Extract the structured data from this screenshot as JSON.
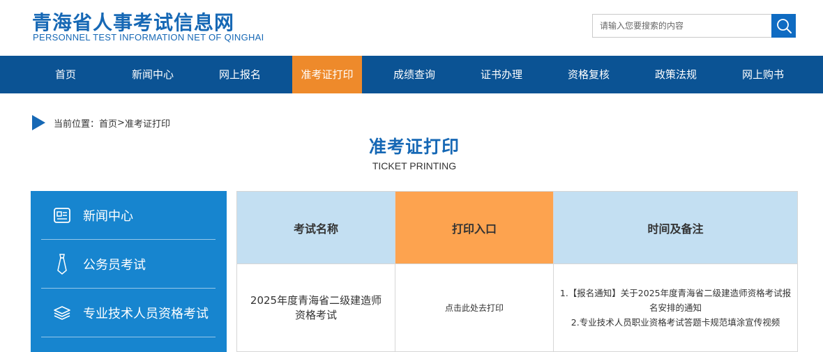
{
  "header": {
    "logo_cn": "青海省人事考试信息网",
    "logo_en": "PERSONNEL TEST INFORMATION NET OF QINGHAI",
    "search_placeholder": "请输入您要搜索的内容",
    "search_icon": "search-icon"
  },
  "nav": {
    "items": [
      {
        "label": "首页",
        "active": false
      },
      {
        "label": "新闻中心",
        "active": false
      },
      {
        "label": "网上报名",
        "active": false
      },
      {
        "label": "准考证打印",
        "active": true
      },
      {
        "label": "成绩查询",
        "active": false
      },
      {
        "label": "证书办理",
        "active": false
      },
      {
        "label": "资格复核",
        "active": false
      },
      {
        "label": "政策法规",
        "active": false
      },
      {
        "label": "网上购书",
        "active": false
      }
    ]
  },
  "breadcrumb": {
    "prefix": "当前位置：",
    "home": "首页",
    "separator": ">",
    "current": "准考证打印"
  },
  "page": {
    "title": "准考证打印",
    "subtitle": "TICKET PRINTING"
  },
  "sidebar": {
    "items": [
      {
        "label": "新闻中心",
        "icon": "news-icon"
      },
      {
        "label": "公务员考试",
        "icon": "tie-icon"
      },
      {
        "label": "专业技术人员资格考试",
        "icon": "layers-icon"
      }
    ]
  },
  "table": {
    "headers": [
      "考试名称",
      "打印入口",
      "时间及备注"
    ],
    "rows": [
      {
        "exam_name": "2025年度青海省二级建造师资格考试",
        "print_link": "点击此处去打印",
        "notes": [
          "1.【报名通知】关于2025年度青海省二级建造师资格考试报名安排的通知",
          "2.专业技术人员职业资格考试答题卡规范填涂宣传视频"
        ]
      }
    ]
  },
  "colors": {
    "brand_blue": "#1668b5",
    "nav_blue": "#0b5394",
    "active_orange": "#ee8a2b",
    "sidebar_blue": "#1785cf",
    "header_light_blue": "#c3dff2",
    "header_orange": "#fda34f"
  }
}
